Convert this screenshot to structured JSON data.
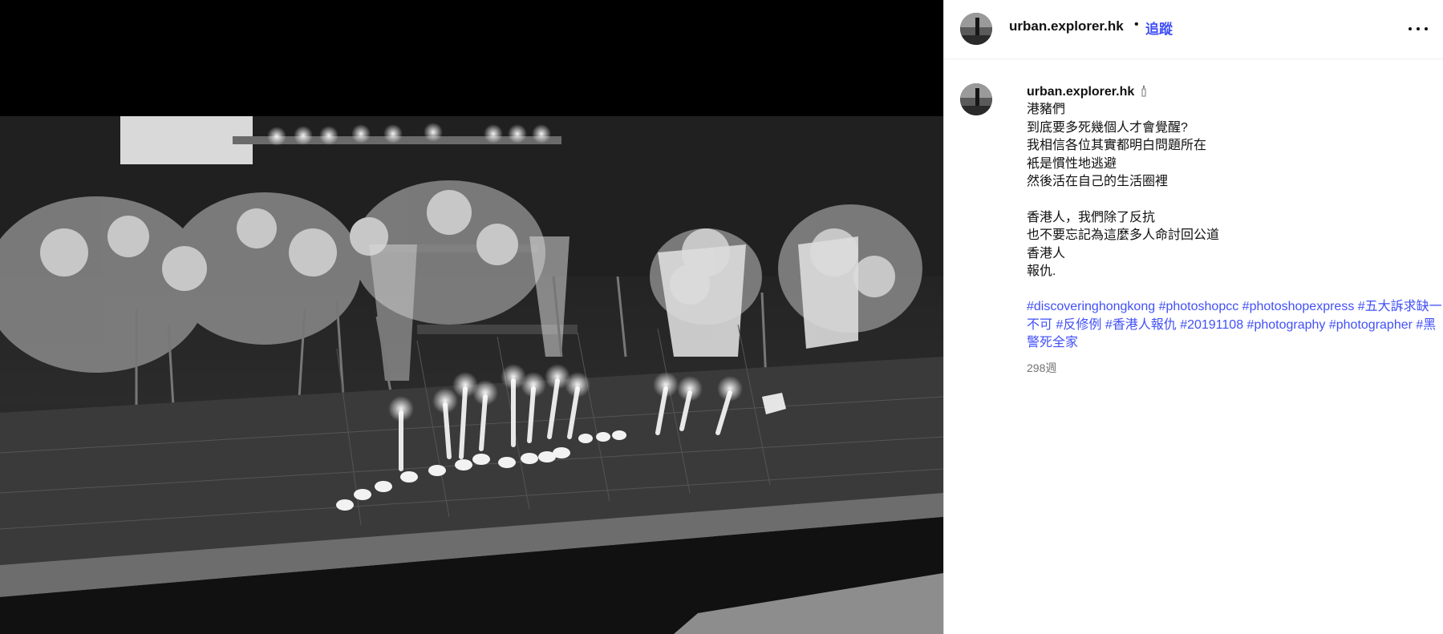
{
  "post": {
    "username": "urban.explorer.hk",
    "separator": "•",
    "follow_label": "追蹤",
    "more_icon": "more-horizontal-icon",
    "image_alt": "Black and white photo of a street memorial with flowers and candles at night"
  },
  "caption": {
    "username": "urban.explorer.hk",
    "lines": [
      "港豬們",
      "到底要多死幾個人才會覺醒?",
      "我相信各位其實都明白問題所在",
      "衹是慣性地逃避",
      "然後活在自己的生活圈裡",
      "",
      "香港人，我們除了反抗",
      "也不要忘記為這麼多人命討回公道",
      "香港人",
      "報仇."
    ],
    "hashtags": [
      "#discoveringhongkong",
      "#photoshopcc",
      "#photoshopexpress",
      "#五大訴求缺一不可",
      "#反修例",
      "#香港人報仇",
      "#20191108",
      "#photography",
      "#photographer",
      "#黑警死全家"
    ],
    "timestamp": "298週"
  },
  "colors": {
    "link": "#4150f7",
    "muted": "#737373"
  }
}
